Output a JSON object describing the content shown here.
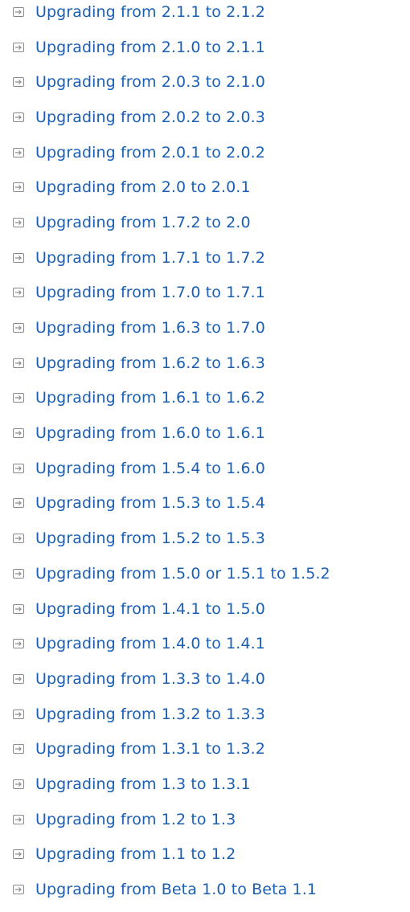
{
  "colors": {
    "link": "#1a5fb4",
    "icon_stroke": "#8a8a8a"
  },
  "icon_name": "expand-arrow-icon",
  "links": [
    {
      "label": "Upgrading from 2.1.1 to 2.1.2"
    },
    {
      "label": "Upgrading from 2.1.0 to 2.1.1"
    },
    {
      "label": "Upgrading from 2.0.3 to 2.1.0"
    },
    {
      "label": "Upgrading from 2.0.2 to 2.0.3"
    },
    {
      "label": "Upgrading from 2.0.1 to 2.0.2"
    },
    {
      "label": "Upgrading from 2.0 to 2.0.1"
    },
    {
      "label": "Upgrading from 1.7.2 to 2.0"
    },
    {
      "label": "Upgrading from 1.7.1 to 1.7.2"
    },
    {
      "label": "Upgrading from 1.7.0 to 1.7.1"
    },
    {
      "label": "Upgrading from 1.6.3 to 1.7.0"
    },
    {
      "label": "Upgrading from 1.6.2 to 1.6.3"
    },
    {
      "label": "Upgrading from 1.6.1 to 1.6.2"
    },
    {
      "label": "Upgrading from 1.6.0 to 1.6.1"
    },
    {
      "label": "Upgrading from 1.5.4 to 1.6.0"
    },
    {
      "label": "Upgrading from 1.5.3 to 1.5.4"
    },
    {
      "label": "Upgrading from 1.5.2 to 1.5.3"
    },
    {
      "label": "Upgrading from 1.5.0 or 1.5.1 to 1.5.2"
    },
    {
      "label": "Upgrading from 1.4.1 to 1.5.0"
    },
    {
      "label": "Upgrading from 1.4.0 to 1.4.1"
    },
    {
      "label": "Upgrading from 1.3.3 to 1.4.0"
    },
    {
      "label": "Upgrading from 1.3.2 to 1.3.3"
    },
    {
      "label": "Upgrading from 1.3.1 to 1.3.2"
    },
    {
      "label": "Upgrading from 1.3 to 1.3.1"
    },
    {
      "label": "Upgrading from 1.2 to 1.3"
    },
    {
      "label": "Upgrading from 1.1 to 1.2"
    },
    {
      "label": "Upgrading from Beta 1.0 to Beta 1.1"
    }
  ]
}
